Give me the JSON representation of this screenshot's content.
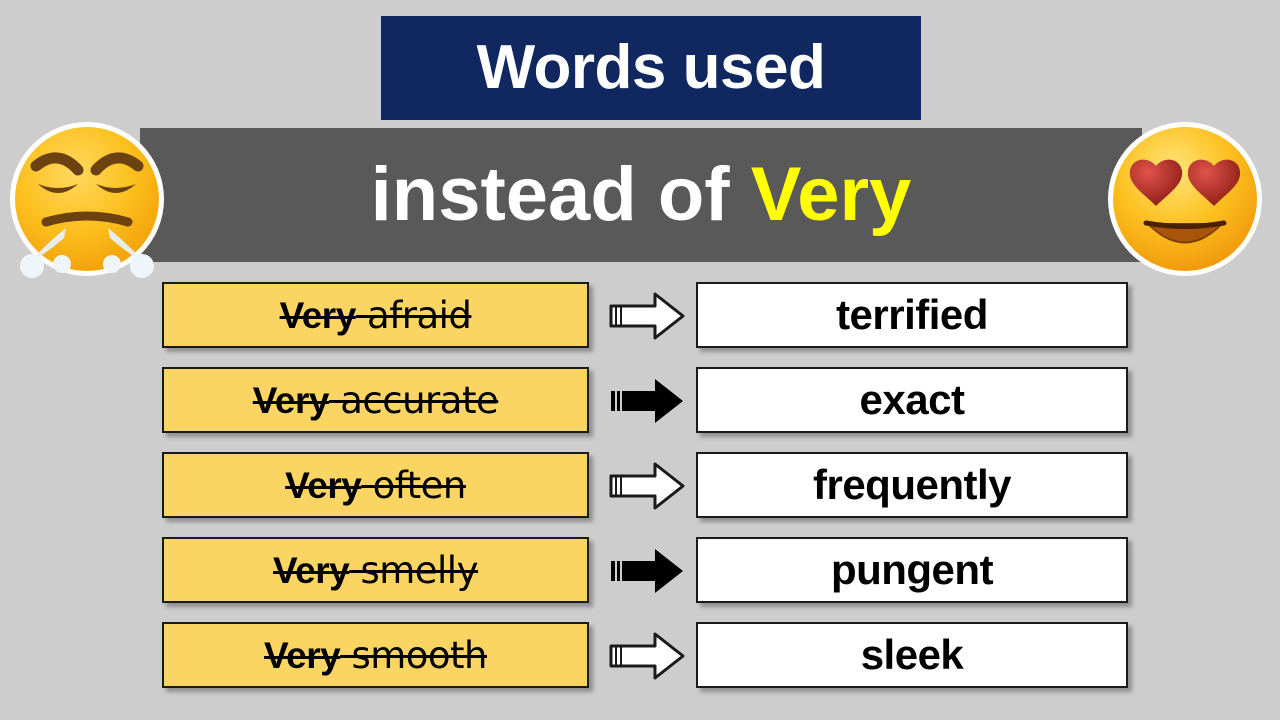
{
  "header": {
    "title": "Words used",
    "subtitle_prefix": "instead of ",
    "subtitle_highlight": "Very",
    "title_bg_color": "#102760",
    "subtitle_bg_color": "#595959",
    "highlight_color": "#ffff00",
    "left_emoji_name": "face-with-steam-from-nose-emoji",
    "right_emoji_name": "smiling-face-with-heart-eyes-emoji"
  },
  "page": {
    "background_color": "#cdcdcd",
    "phrase_box_color": "#fad563",
    "answer_box_color": "#ffffff"
  },
  "rows": [
    {
      "very": "Very",
      "word": " afraid",
      "answer": "terrified",
      "arrow_style": "outline",
      "arrow_name": "arrow-right-outline-icon"
    },
    {
      "very": "Very",
      "word": " accurate",
      "answer": "exact",
      "arrow_style": "solid",
      "arrow_name": "arrow-right-solid-icon"
    },
    {
      "very": "Very",
      "word": " often",
      "answer": "frequently",
      "arrow_style": "outline",
      "arrow_name": "arrow-right-outline-icon"
    },
    {
      "very": "Very",
      "word": " smelly",
      "answer": "pungent",
      "arrow_style": "solid",
      "arrow_name": "arrow-right-solid-icon"
    },
    {
      "very": "Very",
      "word": " smooth",
      "answer": "sleek",
      "arrow_style": "outline",
      "arrow_name": "arrow-right-outline-icon"
    }
  ]
}
